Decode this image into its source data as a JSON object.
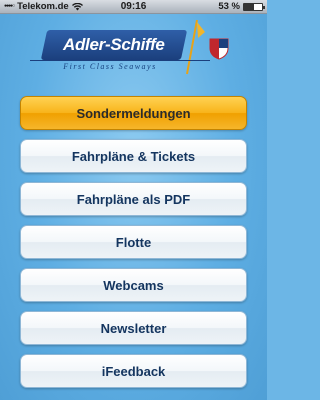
{
  "status_bar": {
    "carrier": "Telekom.de",
    "time": "09:16",
    "battery_text": "53 %",
    "battery_level": 0.53
  },
  "header": {
    "logo_text": "Adler-Schiffe",
    "tagline": "First Class Seaways"
  },
  "menu": {
    "items": [
      {
        "label": "Sondermeldungen",
        "active": true
      },
      {
        "label": "Fahrpläne & Tickets",
        "active": false
      },
      {
        "label": "Fahrpläne als PDF",
        "active": false
      },
      {
        "label": "Flotte",
        "active": false
      },
      {
        "label": "Webcams",
        "active": false
      },
      {
        "label": "Newsletter",
        "active": false
      },
      {
        "label": "iFeedback",
        "active": false
      }
    ]
  },
  "colors": {
    "active_button": "#f8b31a",
    "background": "#6cb6e6",
    "button_text": "#14355f",
    "logo_blue": "#1b3f7d"
  }
}
